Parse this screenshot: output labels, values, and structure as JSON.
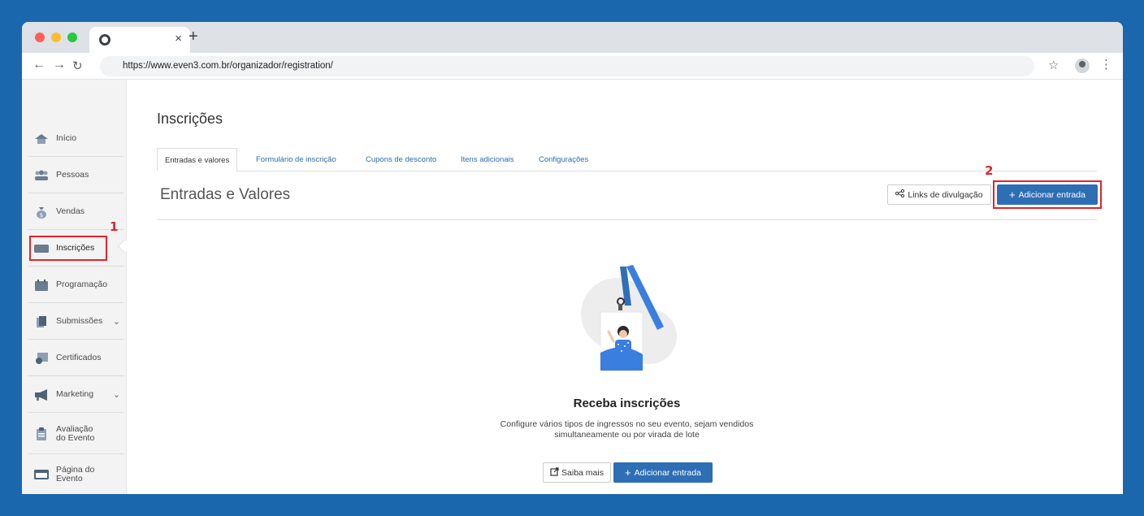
{
  "browser": {
    "url": "https://www.even3.com.br/organizador/registration/",
    "tab_close": "×",
    "new_tab": "+"
  },
  "sidebar": {
    "items": [
      {
        "label": "Início",
        "icon": "home-icon"
      },
      {
        "label": "Pessoas",
        "icon": "people-icon"
      },
      {
        "label": "Vendas",
        "icon": "money-bag-icon"
      },
      {
        "label": "Inscrições",
        "icon": "ticket-icon"
      },
      {
        "label": "Programação",
        "icon": "calendar-icon"
      },
      {
        "label": "Submissões",
        "icon": "document-icon"
      },
      {
        "label": "Certificados",
        "icon": "certificate-icon"
      },
      {
        "label": "Marketing",
        "icon": "megaphone-icon"
      },
      {
        "label_line1": "Avaliação",
        "label_line2": "do Evento",
        "icon": "clipboard-icon"
      },
      {
        "label_line1": "Página do",
        "label_line2": "Evento",
        "icon": "browser-page-icon"
      }
    ]
  },
  "annotations": {
    "step1": "1",
    "step2": "2"
  },
  "main": {
    "title": "Inscrições",
    "tabs": [
      "Entradas e valores",
      "Formulário de inscrição",
      "Cupons de desconto",
      "Itens adicionais",
      "Configurações"
    ],
    "section_title": "Entradas e Valores",
    "links_button": "Links de divulgação",
    "add_button": "Adicionar entrada",
    "empty": {
      "title": "Receba inscrições",
      "desc_line1": "Configure vários tipos de ingressos no seu evento, sejam vendidos",
      "desc_line2": "simultaneamente ou por virada de lote",
      "learn_more": "Saiba mais",
      "add_button": "Adicionar entrada"
    }
  },
  "colors": {
    "background": "#1b67ad",
    "primary_button": "#2e6eb5",
    "highlight": "#e2232b",
    "link": "#2b6cb0"
  }
}
